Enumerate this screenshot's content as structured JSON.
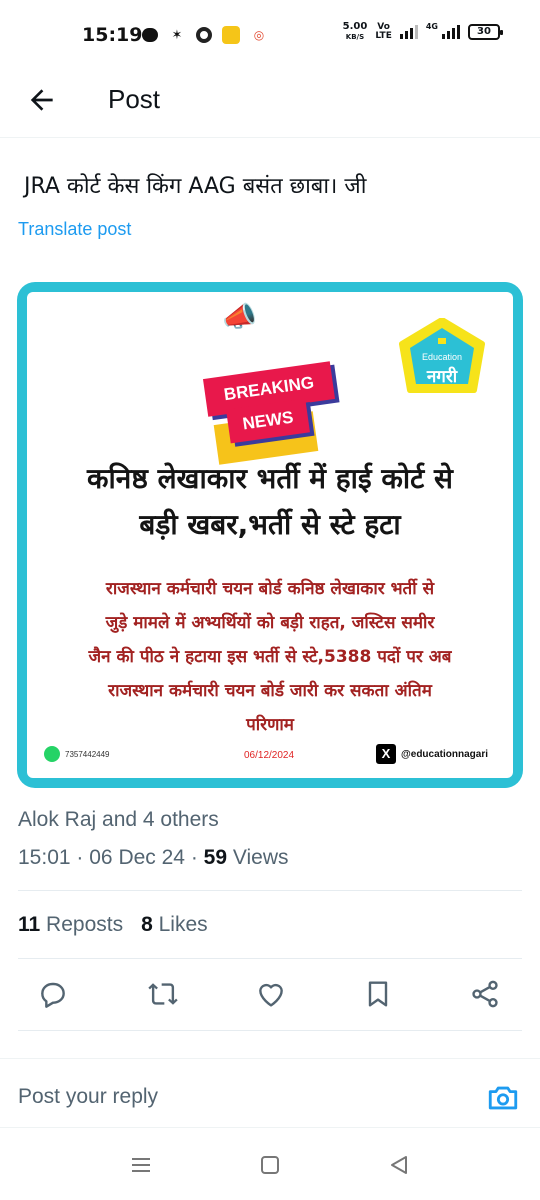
{
  "status_bar": {
    "time": "15:19",
    "net_speed_value": "5.00",
    "net_speed_unit": "KB/S",
    "volte_top": "Vo",
    "volte_bottom": "LTE",
    "network_type": "4G",
    "battery": "30"
  },
  "header": {
    "title": "Post"
  },
  "post": {
    "text": "JRA कोर्ट केस किंग AAG बसंत छाबा। जी",
    "translate_label": "Translate post"
  },
  "media": {
    "breaking_top": "BREAKING",
    "breaking_bottom": "NEWS",
    "logo_label": "Education",
    "logo_hindi": "नगरी",
    "headline_line1": "कनिष्ठ लेखाकार भर्ती में हाई कोर्ट से",
    "headline_line2": "बड़ी खबर,भर्ती से स्टे हटा",
    "body_line1": "राजस्थान कर्मचारी चयन बोर्ड कनिष्ठ लेखाकार भर्ती  से",
    "body_line2": "जुड़े मामले में अभ्यर्थियों को बड़ी राहत, जस्टिस समीर",
    "body_line3": "जैन  की पीठ ने हटाया इस भर्ती से स्टे,5388  पदों पर अब",
    "body_line4": "राजस्थान कर्मचारी चयन बोर्ड जारी कर सकता  अंतिम",
    "body_line5": "परिणाम",
    "phone": "7357442449",
    "date": "06/12/2024",
    "handle": "@educationnagari",
    "x_glyph": "X",
    "colors": {
      "frame": "#2cc0d5",
      "breaking_red": "#e8184b",
      "body_red": "#a22221",
      "logo_teal": "#2cc0d5",
      "logo_yellow": "#f6e31a"
    }
  },
  "meta": {
    "liked_by": "Alok Raj and 4 others",
    "time": "15:01",
    "date": "06 Dec 24",
    "views_count": "59",
    "views_label": "Views",
    "separator": "·"
  },
  "stats": {
    "reposts_count": "11",
    "reposts_label": "Reposts",
    "likes_count": "8",
    "likes_label": "Likes"
  },
  "reply": {
    "placeholder": "Post your reply"
  },
  "icons": {
    "back": "arrow-left-icon",
    "reply": "comment-icon",
    "repost": "repost-icon",
    "like": "heart-icon",
    "bookmark": "bookmark-icon",
    "share": "share-icon",
    "camera": "camera-icon",
    "nav_recents": "menu-icon",
    "nav_home": "square-icon",
    "nav_back": "triangle-back-icon"
  },
  "accent_color": "#1d9bf0"
}
